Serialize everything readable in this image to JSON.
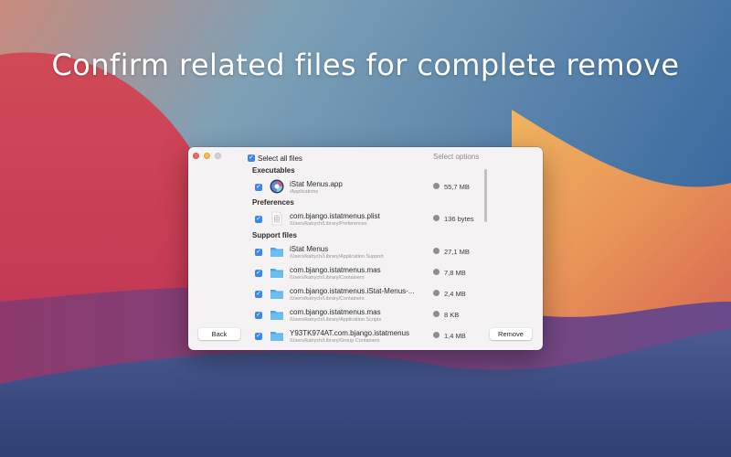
{
  "headline": "Confirm related files for complete remove",
  "window": {
    "select_all_label": "Select all files",
    "select_options_label": "Select options",
    "back_button": "Back",
    "remove_button": "Remove"
  },
  "sections": {
    "executables": "Executables",
    "preferences": "Preferences",
    "support_files": "Support files"
  },
  "files": [
    {
      "name": "iStat Menus.app",
      "path": "/Applications",
      "size": "55,7 MB",
      "icon": "app-icon",
      "checked": true
    },
    {
      "name": "com.bjango.istatmenus.plist",
      "path": "/Users/katrych/Library/Preferences",
      "size": "136 bytes",
      "icon": "plist-file-icon",
      "checked": true
    },
    {
      "name": "iStat Menus",
      "path": "/Users/katrych/Library/Application Support",
      "size": "27,1 MB",
      "icon": "folder-icon",
      "checked": true
    },
    {
      "name": "com.bjango.istatmenus.mas",
      "path": "/Users/katrych/Library/Containers",
      "size": "7,8 MB",
      "icon": "folder-icon",
      "checked": true
    },
    {
      "name": "com.bjango.istatmenus.iStat-Menus-...",
      "path": "/Users/katrych/Library/Containers",
      "size": "2,4 MB",
      "icon": "folder-icon",
      "checked": true
    },
    {
      "name": "com.bjango.istatmenus.mas",
      "path": "/Users/katrych/Library/Application Scripts",
      "size": "8 KB",
      "icon": "folder-icon",
      "checked": true
    },
    {
      "name": "Y93TK974AT.com.bjango.istatmenus",
      "path": "/Users/katrych/Library/Group Containers",
      "size": "1,4 MB",
      "icon": "folder-icon",
      "checked": true
    }
  ],
  "colors": {
    "accent": "#3d86ea",
    "folder": "#5fb4e8",
    "window_bg": "#f4f2f3"
  }
}
